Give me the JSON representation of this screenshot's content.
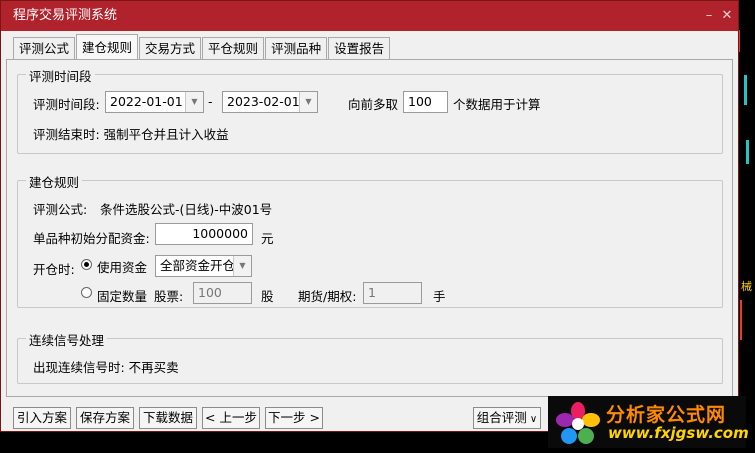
{
  "window": {
    "title": "程序交易评测系统",
    "minimize_icon": "minimize-icon",
    "close_icon": "close-icon"
  },
  "tabs": [
    {
      "label": "评测公式",
      "active": false
    },
    {
      "label": "建仓规则",
      "active": true
    },
    {
      "label": "交易方式",
      "active": false
    },
    {
      "label": "平仓规则",
      "active": false
    },
    {
      "label": "评测品种",
      "active": false
    },
    {
      "label": "设置报告",
      "active": false
    }
  ],
  "period": {
    "legend": "评测时间段",
    "label": "评测时间段:",
    "start_date": "2022-01-01",
    "separator": "-",
    "end_date": "2023-02-01",
    "lookback_prefix": "向前多取",
    "lookback_value": "100",
    "lookback_suffix": "个数据用于计算",
    "end_note": "评测结束时: 强制平仓并且计入收益"
  },
  "open_rules": {
    "legend": "建仓规则",
    "formula_label": "评测公式:",
    "formula_value": "条件选股公式-(日线)-中波01号",
    "capital_label": "单品种初始分配资金:",
    "capital_value": "1000000",
    "capital_unit": "元",
    "open_label": "开仓时:",
    "use_capital_label": "使用资金",
    "use_capital_selected": true,
    "capital_mode": "全部资金开仓",
    "fixed_qty_label": "固定数量",
    "stock_label": "股票:",
    "stock_qty": "100",
    "stock_unit": "股",
    "futures_label": "期货/期权:",
    "futures_qty": "1",
    "futures_unit": "手"
  },
  "signals": {
    "legend": "连续信号处理",
    "text": "出现连续信号时: 不再买卖"
  },
  "buttons": {
    "import": "引入方案",
    "save": "保存方案",
    "download": "下载数据",
    "prev": "< 上一步",
    "next": "下一步 >",
    "combo": "组合评测"
  },
  "watermark": {
    "name": "分析家公式网",
    "url": "www.fxjgsw.com"
  },
  "background": {
    "label": "械"
  },
  "colors": {
    "titlebar": "#b0222c",
    "watermark_name": "#ff8a00",
    "watermark_url": "#ffd400"
  }
}
